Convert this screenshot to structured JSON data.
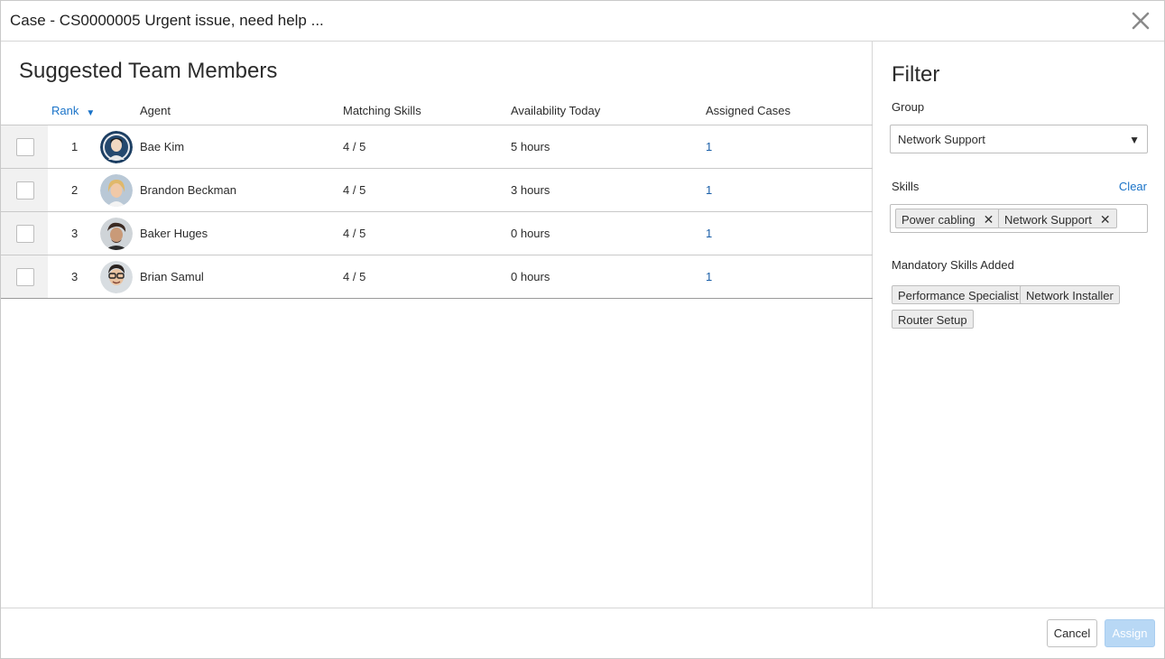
{
  "header": {
    "title": "Case - CS0000005 Urgent issue, need help ..."
  },
  "main": {
    "title": "Suggested Team Members",
    "columns": {
      "rank": "Rank",
      "agent": "Agent",
      "matching_skills": "Matching Skills",
      "availability": "Availability Today",
      "assigned": "Assigned Cases"
    },
    "sort": {
      "column": "Rank",
      "direction": "descending-icon"
    },
    "rows": [
      {
        "rank": "1",
        "agent": "Bae Kim",
        "matching_skills": "4 / 5",
        "availability": "5 hours",
        "assigned": "1",
        "checked": false
      },
      {
        "rank": "2",
        "agent": "Brandon Beckman",
        "matching_skills": "4 / 5",
        "availability": "3 hours",
        "assigned": "1",
        "checked": false
      },
      {
        "rank": "3",
        "agent": "Baker Huges",
        "matching_skills": "4 / 5",
        "availability": "0 hours",
        "assigned": "1",
        "checked": false
      },
      {
        "rank": "3",
        "agent": "Brian Samul",
        "matching_skills": "4 / 5",
        "availability": "0 hours",
        "assigned": "1",
        "checked": false
      }
    ]
  },
  "filter": {
    "title": "Filter",
    "group_label": "Group",
    "group_value": "Network Support",
    "skills_label": "Skills",
    "clear_label": "Clear",
    "skills": [
      "Power cabling",
      "Network Support"
    ],
    "mandatory_label": "Mandatory Skills Added",
    "mandatory_skills": [
      "Performance Specialist",
      "Network Installer",
      "Router Setup"
    ]
  },
  "footer": {
    "cancel_label": "Cancel",
    "assign_label": "Assign"
  },
  "colors": {
    "link": "#1a73c8",
    "assign_disabled": "#b8d8f5",
    "tag_bg": "#ececec"
  }
}
